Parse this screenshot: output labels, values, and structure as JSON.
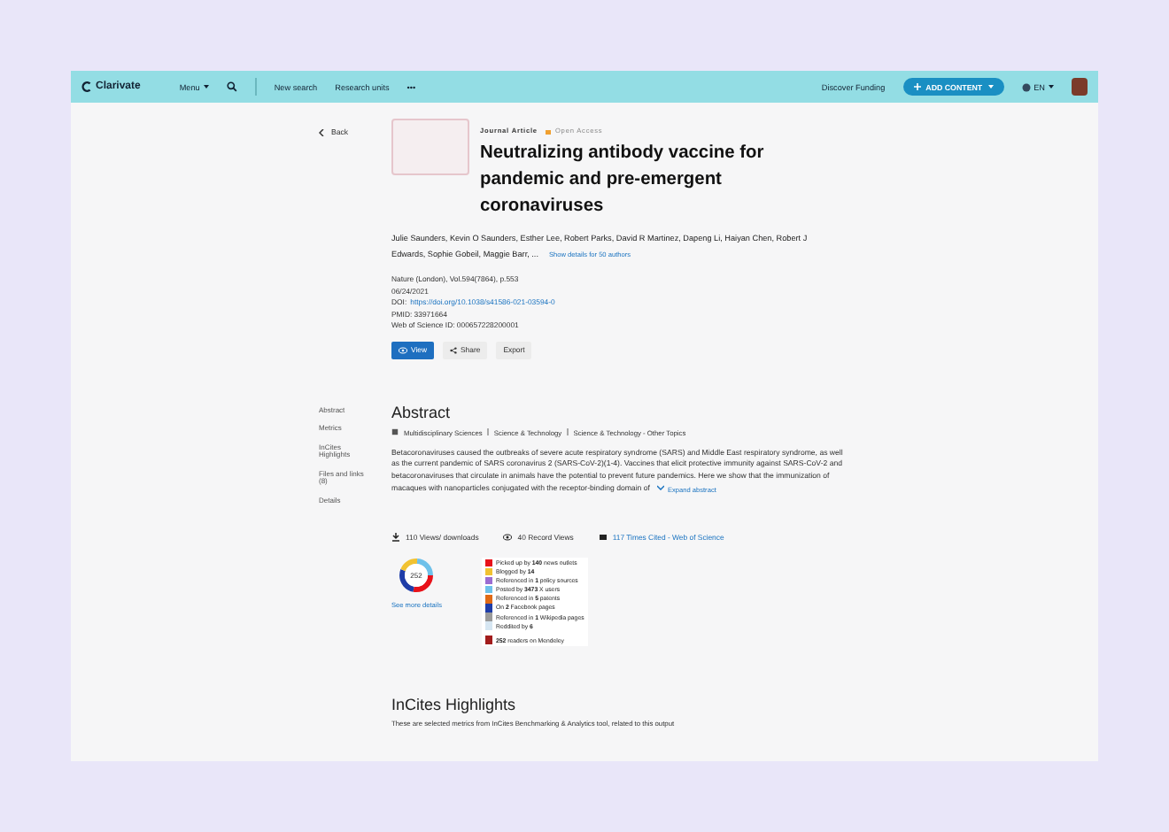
{
  "header": {
    "logo": "Clarivate",
    "menu": "Menu",
    "nav_links": [
      "New search",
      "Research units"
    ],
    "more": "•••",
    "discover": "Discover Funding",
    "add_content": "ADD CONTENT",
    "language": "EN"
  },
  "back": "Back",
  "section_nav": [
    "Abstract",
    "Metrics",
    "InCites Highlights",
    "Files and links (8)",
    "Details"
  ],
  "article": {
    "type": "Journal Article",
    "access": "Open Access",
    "title": "Neutralizing antibody vaccine for pandemic and pre-emergent coronaviruses",
    "authors": "Julie Saunders, Kevin O Saunders, Esther Lee, Robert Parks, David R Martinez, Dapeng Li, Haiyan Chen, Robert J Edwards, Sophie Gobeil, Maggie Barr, ...",
    "show_authors": "Show details for 50 authors",
    "source": "Nature (London), Vol.594(7864), p.553",
    "date": "06/24/2021",
    "doi_label": "DOI:",
    "doi": "https://doi.org/10.1038/s41586-021-03594-0",
    "pmid": "PMID: 33971664",
    "wos_id": "Web of Science ID: 000657228200001",
    "actions": [
      {
        "label": "View",
        "kind": "primary"
      },
      {
        "label": "Share",
        "kind": "share"
      },
      {
        "label": "Export",
        "kind": "plain"
      }
    ]
  },
  "abstract": {
    "heading": "Abstract",
    "categories": [
      "Multidisciplinary Sciences",
      "Science & Technology",
      "Science & Technology - Other Topics"
    ],
    "text": "Betacoronaviruses caused the outbreaks of severe acute respiratory syndrome (SARS) and Middle East respiratory syndrome, as well as the current pandemic of SARS coronavirus 2 (SARS-CoV-2)(1-4). Vaccines that elicit protective immunity against SARS-CoV-2 and betacoronaviruses that circulate in animals have the potential to prevent future pandemics. Here we show that the immunization of macaques with nanoparticles conjugated with the receptor-binding domain of",
    "expand": "Expand abstract"
  },
  "metrics": {
    "views": "110 Views/ downloads",
    "record_views": "40 Record Views",
    "cited": "117 Times Cited - Web of Science",
    "score": "252",
    "see_more": "See more details",
    "legend": [
      {
        "text": "Picked up by **140** news outlets",
        "color": "#e8121a"
      },
      {
        "text": "Blogged by **14**",
        "color": "#f1c232"
      },
      {
        "text": "Referenced in **1** policy sources",
        "color": "#9b6dd2"
      },
      {
        "text": "Posted by **3473** X users",
        "color": "#6ec1ea"
      },
      {
        "text": "Referenced in **5** patents",
        "color": "#e06a16"
      },
      {
        "text": "On **2** Facebook pages",
        "color": "#1f3da8"
      },
      {
        "text": "Referenced in **1** Wikipedia pages",
        "color": "#9a9a9a"
      },
      {
        "text": "Reddited by **6**",
        "color": "#d6e6f2"
      }
    ],
    "mendeley": {
      "text": "**252** readers on Mendeley",
      "color": "#a21c1c"
    }
  },
  "incites": {
    "heading": "InCites Highlights",
    "text": "These are selected metrics from InCites Benchmarking & Analytics tool, related to this output"
  }
}
